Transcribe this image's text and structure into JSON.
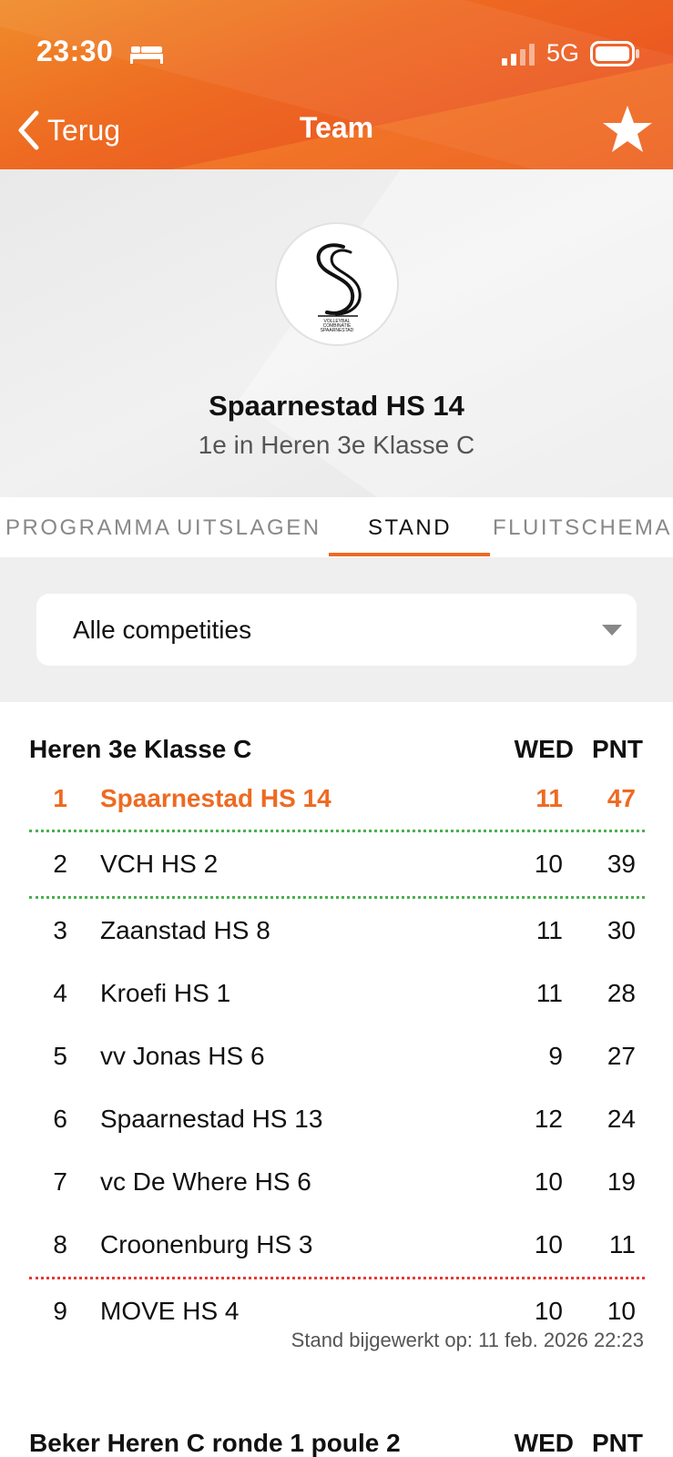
{
  "status_bar": {
    "time": "23:30",
    "network": "5G"
  },
  "nav": {
    "back_label": "Terug",
    "title": "Team"
  },
  "team": {
    "logo_lines": [
      "VOLLEYBAL",
      "COMBINATIE",
      "SPAARNESTAD"
    ],
    "name": "Spaarnestad HS 14",
    "subtitle": "1e in Heren 3e Klasse C"
  },
  "tabs": [
    {
      "label": "PROGRAMMA",
      "active": false
    },
    {
      "label": "UITSLAGEN",
      "active": false
    },
    {
      "label": "STAND",
      "active": true
    },
    {
      "label": "FLUITSCHEMA",
      "active": false
    }
  ],
  "filter": {
    "selected": "Alle competities"
  },
  "standings": {
    "title": "Heren 3e Klasse C",
    "col_wed": "WED",
    "col_pnt": "PNT",
    "rows": [
      {
        "pos": "1",
        "team": "Spaarnestad HS 14",
        "wed": "11",
        "pnt": "47",
        "highlight": true
      },
      {
        "pos": "2",
        "team": "VCH HS 2",
        "wed": "10",
        "pnt": "39"
      },
      {
        "pos": "3",
        "team": "Zaanstad HS 8",
        "wed": "11",
        "pnt": "30"
      },
      {
        "pos": "4",
        "team": "Kroefi HS 1",
        "wed": "11",
        "pnt": "28"
      },
      {
        "pos": "5",
        "team": "vv Jonas HS 6",
        "wed": "9",
        "pnt": "27"
      },
      {
        "pos": "6",
        "team": "Spaarnestad HS 13",
        "wed": "12",
        "pnt": "24"
      },
      {
        "pos": "7",
        "team": "vc De Where HS 6",
        "wed": "10",
        "pnt": "19"
      },
      {
        "pos": "8",
        "team": "Croonenburg HS 3",
        "wed": "10",
        "pnt": "11"
      },
      {
        "pos": "9",
        "team": "MOVE HS 4",
        "wed": "10",
        "pnt": "10"
      }
    ],
    "updated": "Stand bijgewerkt op: 11 feb. 2026 22:23"
  },
  "standings2": {
    "title": "Beker Heren C ronde 1 poule 2",
    "col_wed": "WED",
    "col_pnt": "PNT"
  },
  "colors": {
    "accent": "#ee6a22",
    "promotion": "#4caf50",
    "relegation": "#e53935"
  }
}
